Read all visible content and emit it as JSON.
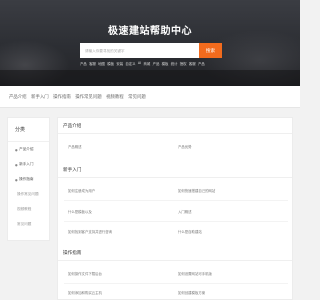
{
  "hero": {
    "title": "极速建站帮助中心",
    "search_placeholder": "请输入你要寻找的关键字",
    "search_button": "搜索",
    "hot_tags": [
      "产品",
      "客服",
      "地图",
      "模板",
      "安装",
      "自定义",
      "AI",
      "商城",
      "产品",
      "模板",
      "统计",
      "授权",
      "客服",
      "产品"
    ]
  },
  "nav": {
    "items": [
      "产品介绍",
      "新手入门",
      "操作指南",
      "操作常见问题",
      "视频教程",
      "常见问题"
    ]
  },
  "sidebar": {
    "heading": "分类",
    "items": [
      {
        "label": "产品介绍",
        "sub": false
      },
      {
        "label": "新手入门",
        "sub": false
      },
      {
        "label": "操作指南",
        "sub": false
      },
      {
        "label": "操作常见问题",
        "sub": true
      },
      {
        "label": "视频教程",
        "sub": true
      },
      {
        "label": "常见问题",
        "sub": true
      }
    ]
  },
  "main": {
    "sections": [
      {
        "title": "产品介绍",
        "items": [
          "产品概述",
          "产品优势"
        ]
      },
      {
        "title": "新手入门",
        "items": [
          "如何注册成为用户",
          "如何快速搭建自己的网站",
          "什么是模板以及",
          "入门概述",
          "如何找到客户支持并进行咨询",
          "什么是自助建站"
        ]
      },
      {
        "title": "操作指南",
        "items": [
          "如何操作文件下载后台",
          "如何设置网站可手机版",
          "如何添加和购买云主机",
          "如何创建模板方案"
        ]
      }
    ]
  }
}
